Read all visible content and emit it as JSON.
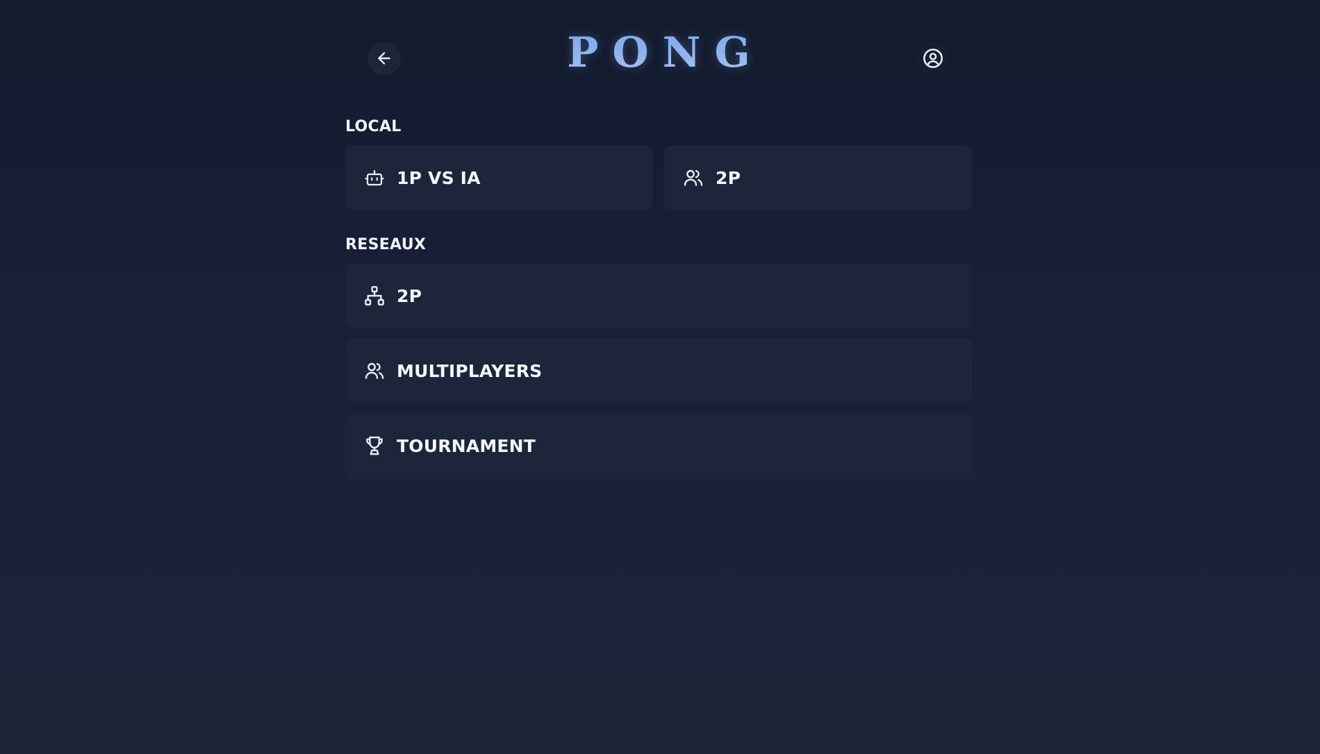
{
  "header": {
    "title": "PONG",
    "back_icon": "arrow-left-icon",
    "profile_icon": "user-circle-icon"
  },
  "local": {
    "label": "LOCAL",
    "buttons": [
      {
        "label": "1P VS IA",
        "icon": "robot-icon"
      },
      {
        "label": "2P",
        "icon": "users-icon"
      }
    ]
  },
  "reseaux": {
    "label": "RESEAUX",
    "buttons": [
      {
        "label": "2P",
        "icon": "network-icon"
      },
      {
        "label": "MULTIPLAYERS",
        "icon": "users-icon"
      },
      {
        "label": "TOURNAMENT",
        "icon": "trophy-icon"
      }
    ]
  },
  "colors": {
    "background": "#161d31",
    "card": "#1c253a",
    "title": "#8fb2ee",
    "text": "#f3f6fb"
  }
}
